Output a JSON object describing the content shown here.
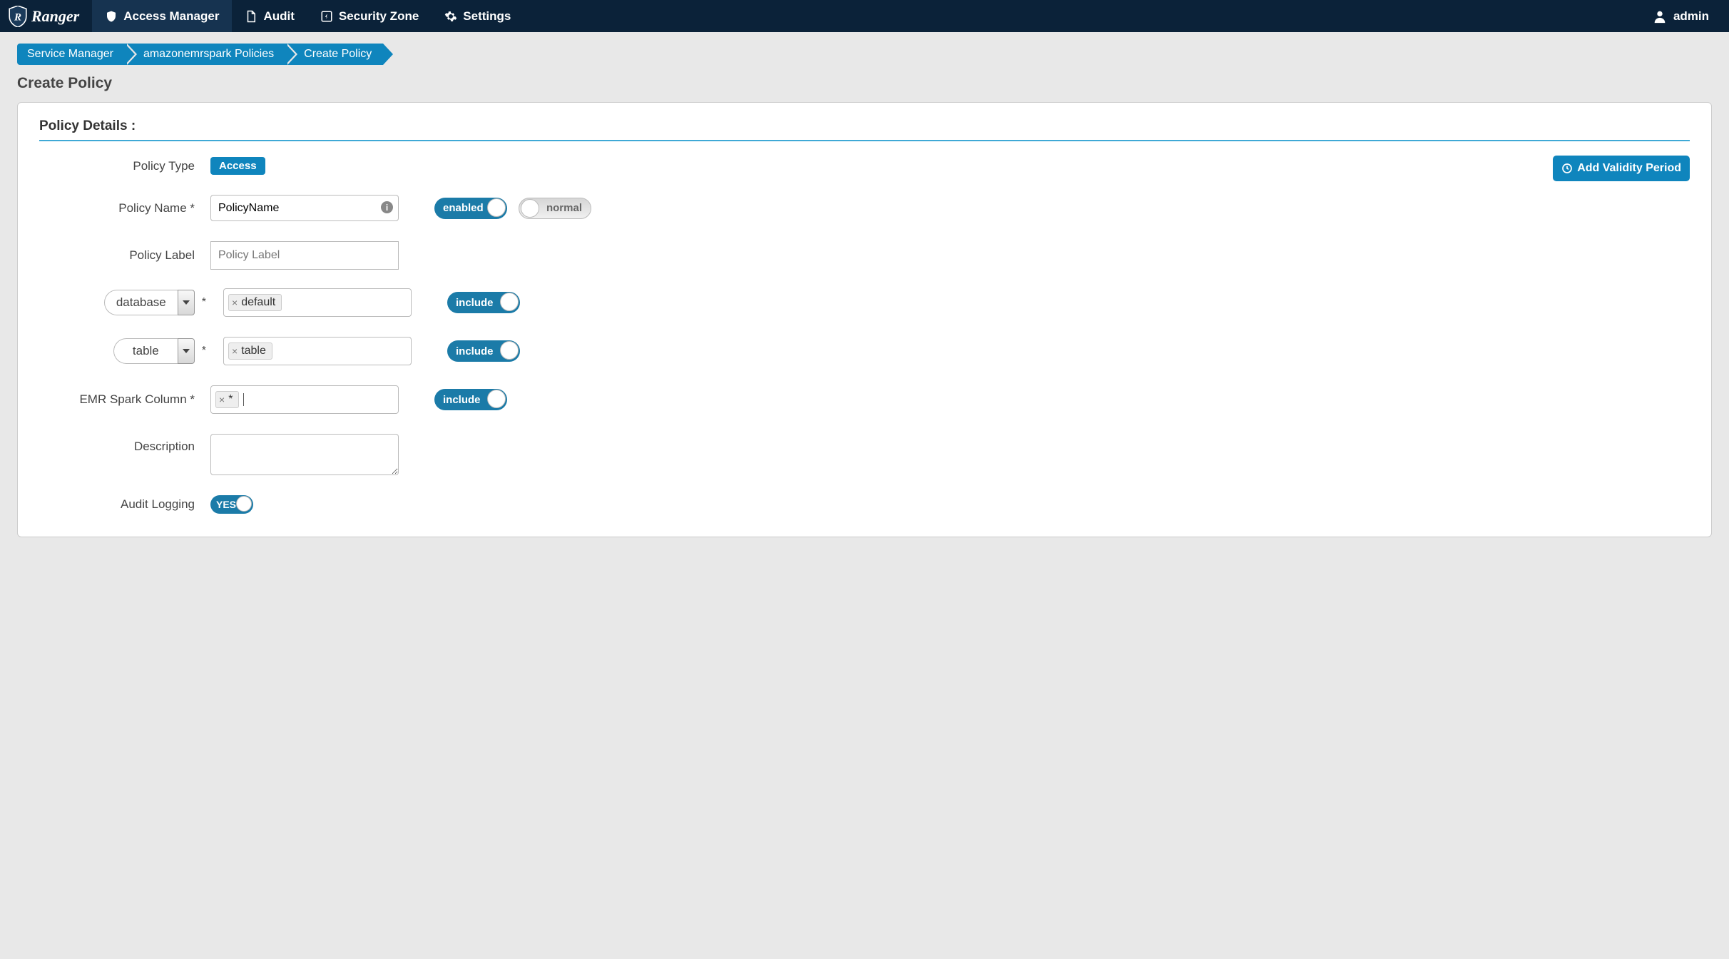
{
  "brand": "Ranger",
  "nav": {
    "access_manager": "Access Manager",
    "audit": "Audit",
    "security_zone": "Security Zone",
    "settings": "Settings",
    "user": "admin"
  },
  "breadcrumb": {
    "service_manager": "Service Manager",
    "policies": "amazonemrspark Policies",
    "create": "Create Policy"
  },
  "page_title": "Create Policy",
  "section_title": "Policy Details :",
  "labels": {
    "policy_type": "Policy Type",
    "policy_name": "Policy Name *",
    "policy_label": "Policy Label",
    "database": "database",
    "table": "table",
    "emr_spark_column": "EMR Spark Column *",
    "description": "Description",
    "audit_logging": "Audit Logging"
  },
  "values": {
    "policy_type_badge": "Access",
    "policy_name": "PolicyName",
    "policy_label_placeholder": "Policy Label",
    "database_tag": "default",
    "table_tag": "table",
    "column_tag": "*",
    "description": ""
  },
  "toggles": {
    "enabled": "enabled",
    "normal": "normal",
    "include": "include",
    "yes": "YES"
  },
  "buttons": {
    "add_validity": "Add Validity Period"
  }
}
